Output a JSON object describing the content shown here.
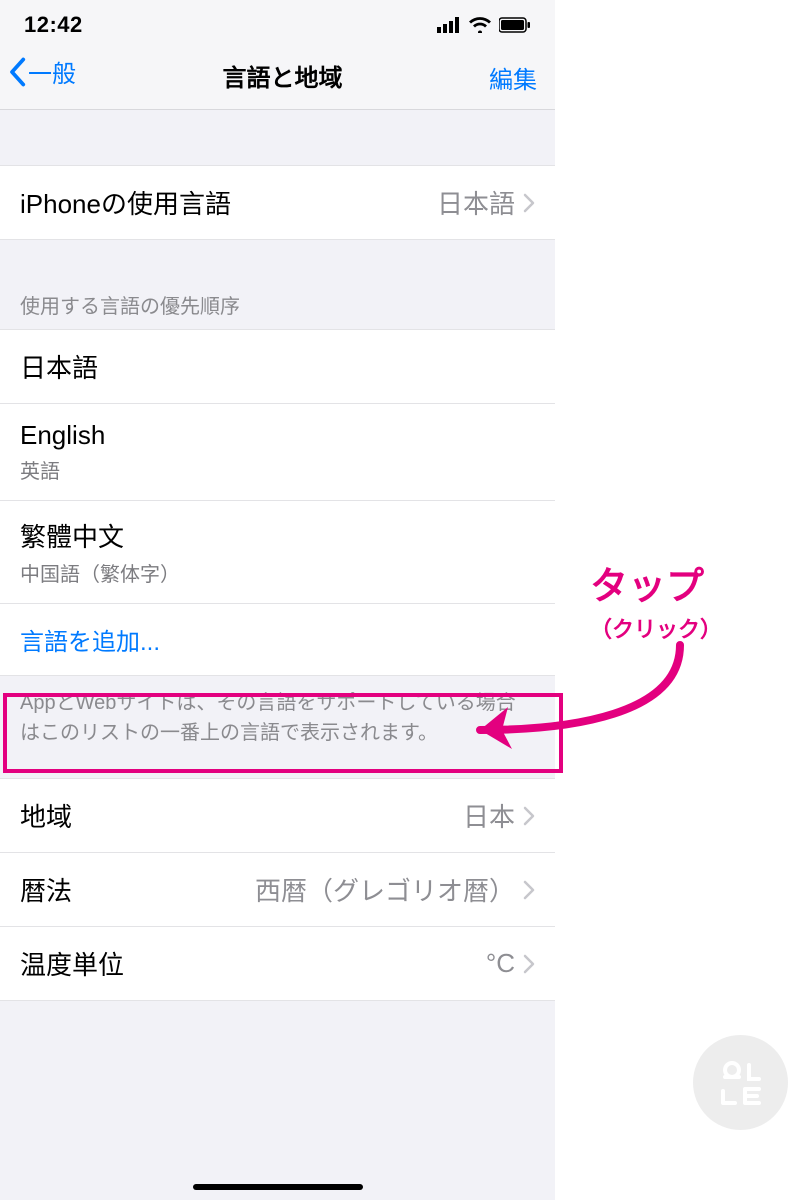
{
  "status": {
    "time": "12:42"
  },
  "nav": {
    "back": "一般",
    "title": "言語と地域",
    "edit": "編集"
  },
  "iphone_lang": {
    "label": "iPhoneの使用言語",
    "value": "日本語"
  },
  "pref_header": "使用する言語の優先順序",
  "langs": [
    {
      "name": "日本語",
      "sub": ""
    },
    {
      "name": "English",
      "sub": "英語"
    },
    {
      "name": "繁體中文",
      "sub": "中国語（繁体字）"
    }
  ],
  "add_lang": "言語を追加...",
  "pref_footer": "AppとWebサイトは、その言語をサポートしている場合はこのリストの一番上の言語で表示されます。",
  "region": {
    "label": "地域",
    "value": "日本"
  },
  "calendar": {
    "label": "暦法",
    "value": "西暦（グレゴリオ暦）"
  },
  "temp": {
    "label": "温度単位",
    "value": "°C"
  },
  "annotation": {
    "big": "タップ",
    "small": "（クリック）"
  }
}
